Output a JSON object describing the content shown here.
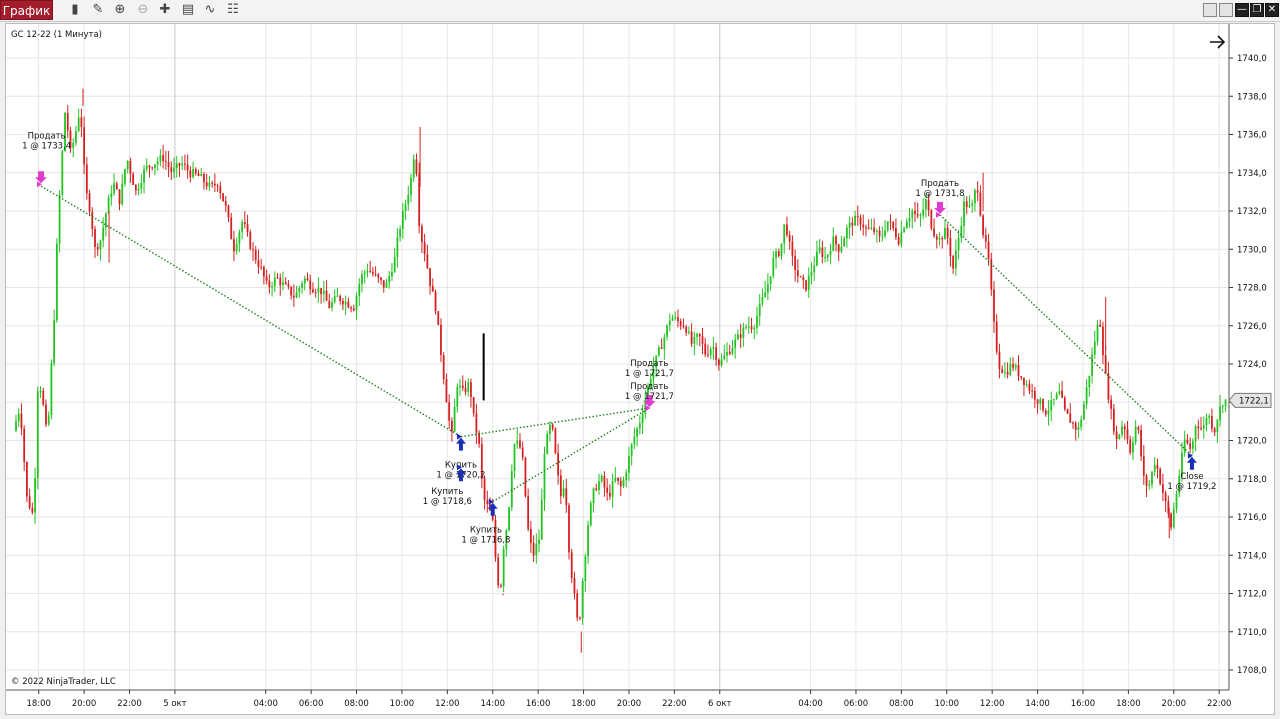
{
  "window": {
    "title": "График"
  },
  "toolbar": {
    "icons": [
      "bar-style-icon",
      "pencil-icon",
      "zoom-in-icon",
      "zoom-out-icon",
      "crosshair-icon",
      "properties-icon",
      "indicator-icon",
      "templates-icon"
    ]
  },
  "colors": {
    "up": "#22c322",
    "down": "#d42020",
    "marker_sell": "#e03cd0",
    "marker_buy": "#1a2fb5",
    "trade_line": "#208020",
    "grid": "#e6e6e6",
    "price_tag": "#e4e4e4"
  },
  "chart_data": {
    "type": "candlestick",
    "title": "GC 12-22 (1 Минута)",
    "copyright": "© 2022 NinjaTrader, LLC",
    "ylim": [
      1707.0,
      1742.0
    ],
    "y_ticks": [
      "1740,0",
      "1738,0",
      "1736,0",
      "1734,0",
      "1732,0",
      "1730,0",
      "1728,0",
      "1726,0",
      "1724,0",
      "1722,0",
      "1720,0",
      "1718,0",
      "1716,0",
      "1714,0",
      "1712,0",
      "1710,0",
      "1708,0"
    ],
    "x_ticks": [
      "18:00",
      "20:00",
      "22:00",
      "5 окт",
      "04:00",
      "06:00",
      "08:00",
      "10:00",
      "12:00",
      "14:00",
      "16:00",
      "18:00",
      "20:00",
      "22:00",
      "6 окт",
      "04:00",
      "06:00",
      "08:00",
      "10:00",
      "12:00",
      "14:00",
      "16:00",
      "18:00",
      "20:00",
      "22:00"
    ],
    "x_tick_hours": [
      18,
      20,
      22,
      24,
      28,
      30,
      32,
      34,
      36,
      38,
      40,
      42,
      44,
      46,
      48,
      52,
      54,
      56,
      58,
      60,
      62,
      64,
      66,
      68,
      70
    ],
    "x_range_hours": [
      17.0,
      70.3
    ],
    "last_price": "1722,1",
    "price_path": [
      [
        17.0,
        1720.5
      ],
      [
        17.3,
        1721.8
      ],
      [
        17.6,
        1717.0
      ],
      [
        17.9,
        1716.0
      ],
      [
        18.1,
        1723.5
      ],
      [
        18.3,
        1722.0
      ],
      [
        18.5,
        1720.0
      ],
      [
        18.8,
        1726.5
      ],
      [
        18.95,
        1731.0
      ],
      [
        19.1,
        1734.0
      ],
      [
        19.3,
        1737.5
      ],
      [
        19.5,
        1735.0
      ],
      [
        19.7,
        1735.8
      ],
      [
        19.95,
        1737.5
      ],
      [
        20.1,
        1734.5
      ],
      [
        20.2,
        1733.0
      ],
      [
        20.4,
        1732.0
      ],
      [
        20.6,
        1730.0
      ],
      [
        20.85,
        1730.5
      ],
      [
        21.1,
        1732.0
      ],
      [
        21.4,
        1733.5
      ],
      [
        21.7,
        1732.5
      ],
      [
        22.0,
        1734.8
      ],
      [
        22.4,
        1733.0
      ],
      [
        22.8,
        1734.2
      ],
      [
        23.2,
        1734.5
      ],
      [
        23.6,
        1734.8
      ],
      [
        24.0,
        1734.0
      ],
      [
        24.4,
        1734.5
      ],
      [
        24.8,
        1734.0
      ],
      [
        25.2,
        1733.8
      ],
      [
        25.7,
        1733.2
      ],
      [
        26.0,
        1733.5
      ],
      [
        26.4,
        1732.0
      ],
      [
        26.7,
        1730.0
      ],
      [
        27.1,
        1731.5
      ],
      [
        27.5,
        1730.0
      ],
      [
        27.9,
        1729.0
      ],
      [
        28.2,
        1728.0
      ],
      [
        28.6,
        1728.5
      ],
      [
        29.0,
        1728.0
      ],
      [
        29.4,
        1727.5
      ],
      [
        29.8,
        1728.5
      ],
      [
        30.2,
        1728.0
      ],
      [
        30.6,
        1727.8
      ],
      [
        30.9,
        1727.0
      ],
      [
        31.3,
        1727.5
      ],
      [
        31.7,
        1727.2
      ],
      [
        32.0,
        1727.0
      ],
      [
        32.3,
        1728.5
      ],
      [
        32.6,
        1729.0
      ],
      [
        33.0,
        1728.5
      ],
      [
        33.4,
        1728.0
      ],
      [
        33.8,
        1729.5
      ],
      [
        34.0,
        1731.0
      ],
      [
        34.3,
        1732.5
      ],
      [
        34.5,
        1733.5
      ],
      [
        34.7,
        1735.5
      ],
      [
        34.9,
        1731.0
      ],
      [
        35.1,
        1730.0
      ],
      [
        35.4,
        1728.0
      ],
      [
        35.6,
        1727.0
      ],
      [
        35.9,
        1724.0
      ],
      [
        36.1,
        1722.0
      ],
      [
        36.3,
        1720.0
      ],
      [
        36.55,
        1723.0
      ],
      [
        36.8,
        1722.5
      ],
      [
        37.1,
        1723.0
      ],
      [
        37.3,
        1721.0
      ],
      [
        37.5,
        1720.0
      ],
      [
        37.7,
        1717.0
      ],
      [
        37.9,
        1716.5
      ],
      [
        38.1,
        1716.0
      ],
      [
        38.3,
        1713.0
      ],
      [
        38.45,
        1712.0
      ],
      [
        38.6,
        1714.5
      ],
      [
        38.8,
        1716.0
      ],
      [
        38.95,
        1718.5
      ],
      [
        39.1,
        1720.0
      ],
      [
        39.4,
        1719.5
      ],
      [
        39.7,
        1715.0
      ],
      [
        39.9,
        1714.0
      ],
      [
        40.2,
        1715.0
      ],
      [
        40.4,
        1719.5
      ],
      [
        40.7,
        1721.0
      ],
      [
        40.9,
        1719.0
      ],
      [
        41.1,
        1717.0
      ],
      [
        41.3,
        1718.0
      ],
      [
        41.5,
        1714.0
      ],
      [
        41.7,
        1712.0
      ],
      [
        41.9,
        1710.0
      ],
      [
        42.1,
        1713.0
      ],
      [
        42.35,
        1716.0
      ],
      [
        42.6,
        1717.5
      ],
      [
        42.9,
        1718.0
      ],
      [
        43.2,
        1717.0
      ],
      [
        43.5,
        1718.0
      ],
      [
        43.8,
        1717.5
      ],
      [
        44.0,
        1718.5
      ],
      [
        44.3,
        1720.0
      ],
      [
        44.6,
        1721.0
      ],
      [
        44.9,
        1722.5
      ],
      [
        45.1,
        1723.5
      ],
      [
        45.4,
        1724.5
      ],
      [
        45.7,
        1725.5
      ],
      [
        45.95,
        1726.5
      ],
      [
        46.3,
        1726.2
      ],
      [
        46.6,
        1726.0
      ],
      [
        46.9,
        1725.0
      ],
      [
        47.2,
        1725.5
      ],
      [
        47.5,
        1724.5
      ],
      [
        47.8,
        1725.0
      ],
      [
        48.1,
        1724.0
      ],
      [
        48.4,
        1724.5
      ],
      [
        48.7,
        1725.0
      ],
      [
        49.0,
        1725.5
      ],
      [
        49.3,
        1726.0
      ],
      [
        49.6,
        1726.0
      ],
      [
        49.9,
        1727.0
      ],
      [
        50.2,
        1728.0
      ],
      [
        50.5,
        1729.5
      ],
      [
        50.8,
        1730.0
      ],
      [
        51.0,
        1731.5
      ],
      [
        51.3,
        1729.5
      ],
      [
        51.6,
        1728.5
      ],
      [
        51.9,
        1728.0
      ],
      [
        52.2,
        1729.0
      ],
      [
        52.5,
        1730.0
      ],
      [
        52.8,
        1729.5
      ],
      [
        53.1,
        1730.5
      ],
      [
        53.4,
        1730.0
      ],
      [
        53.7,
        1731.0
      ],
      [
        54.0,
        1731.5
      ],
      [
        54.3,
        1731.5
      ],
      [
        54.6,
        1731.0
      ],
      [
        54.9,
        1731.0
      ],
      [
        55.2,
        1730.5
      ],
      [
        55.5,
        1731.5
      ],
      [
        55.8,
        1731.0
      ],
      [
        56.0,
        1730.5
      ],
      [
        56.3,
        1731.5
      ],
      [
        56.6,
        1732.0
      ],
      [
        56.9,
        1731.5
      ],
      [
        57.2,
        1732.5
      ],
      [
        57.5,
        1731.0
      ],
      [
        57.8,
        1730.5
      ],
      [
        58.1,
        1731.0
      ],
      [
        58.4,
        1729.0
      ],
      [
        58.7,
        1731.0
      ],
      [
        58.9,
        1732.5
      ],
      [
        59.2,
        1732.0
      ],
      [
        59.45,
        1733.5
      ],
      [
        59.7,
        1731.0
      ],
      [
        59.95,
        1729.5
      ],
      [
        60.2,
        1726.0
      ],
      [
        60.4,
        1724.0
      ],
      [
        60.7,
        1723.5
      ],
      [
        61.0,
        1724.0
      ],
      [
        61.3,
        1723.5
      ],
      [
        61.6,
        1723.0
      ],
      [
        61.9,
        1722.5
      ],
      [
        62.2,
        1722.0
      ],
      [
        62.5,
        1721.5
      ],
      [
        62.8,
        1722.0
      ],
      [
        63.1,
        1722.5
      ],
      [
        63.3,
        1721.5
      ],
      [
        63.6,
        1721.0
      ],
      [
        63.9,
        1720.5
      ],
      [
        64.1,
        1721.5
      ],
      [
        64.4,
        1723.5
      ],
      [
        64.6,
        1725.0
      ],
      [
        64.85,
        1726.5
      ],
      [
        65.1,
        1723.5
      ],
      [
        65.35,
        1721.5
      ],
      [
        65.6,
        1720.0
      ],
      [
        65.9,
        1721.0
      ],
      [
        66.2,
        1719.5
      ],
      [
        66.5,
        1721.0
      ],
      [
        66.8,
        1718.0
      ],
      [
        67.0,
        1717.5
      ],
      [
        67.3,
        1719.0
      ],
      [
        67.5,
        1718.0
      ],
      [
        67.8,
        1716.5
      ],
      [
        68.0,
        1715.5
      ],
      [
        68.2,
        1717.0
      ],
      [
        68.4,
        1718.5
      ],
      [
        68.6,
        1720.0
      ],
      [
        68.9,
        1719.5
      ],
      [
        69.1,
        1721.0
      ],
      [
        69.4,
        1720.5
      ],
      [
        69.6,
        1721.5
      ],
      [
        69.9,
        1720.5
      ],
      [
        70.1,
        1721.5
      ],
      [
        70.3,
        1722.1
      ]
    ],
    "extreme_points": [
      [
        19.95,
        1738.4
      ],
      [
        21.1,
        1729.3
      ],
      [
        34.8,
        1736.4
      ],
      [
        38.45,
        1711.9
      ],
      [
        41.9,
        1708.9
      ],
      [
        59.6,
        1734.0
      ],
      [
        65.0,
        1727.5
      ],
      [
        67.8,
        1714.9
      ]
    ],
    "trades": [
      {
        "entry_hour": 18.1,
        "entry_price": 1733.3,
        "exit_hour": 36.6,
        "exit_price": 1720.2
      },
      {
        "entry_hour": 36.6,
        "entry_price": 1720.2,
        "exit_hour": 44.9,
        "exit_price": 1721.7
      },
      {
        "entry_hour": 38.0,
        "entry_price": 1716.8,
        "exit_hour": 44.9,
        "exit_price": 1721.7
      },
      {
        "entry_hour": 57.7,
        "entry_price": 1731.8,
        "exit_hour": 68.8,
        "exit_price": 1719.2
      }
    ],
    "annotations": [
      {
        "kind": "sell",
        "lines": [
          "Продать",
          "1 @ 1733,4"
        ],
        "hour": 18.1,
        "price": 1733.4,
        "label_hour": 18.35,
        "label_price": 1735.8
      },
      {
        "kind": "buy",
        "lines": [
          "Купить",
          "1 @ 1720,2"
        ],
        "hour": 36.6,
        "price": 1720.2,
        "label_hour": 36.6,
        "label_price": 1718.6
      },
      {
        "kind": "buy",
        "lines": [
          "Купить",
          "1 @ 1718,6"
        ],
        "hour": 36.6,
        "price": 1718.6,
        "label_hour": 36.0,
        "label_price": 1717.2
      },
      {
        "kind": "buy",
        "lines": [
          "Купить",
          "1 @ 1716,8"
        ],
        "hour": 38.0,
        "price": 1716.8,
        "label_hour": 37.7,
        "label_price": 1715.2
      },
      {
        "kind": "sell",
        "lines": [
          "Продать",
          "1 @ 1721,7"
        ],
        "hour": 44.9,
        "price": 1721.7,
        "label_hour": 44.9,
        "label_price": 1723.9
      },
      {
        "kind": "sell",
        "lines": [
          "Продать",
          "1 @ 1721,7"
        ],
        "hour": 44.9,
        "price": 1721.7,
        "label_hour": 44.9,
        "label_price": 1722.7
      },
      {
        "kind": "sell",
        "lines": [
          "Продать",
          "1 @ 1731,8"
        ],
        "hour": 57.7,
        "price": 1731.8,
        "label_hour": 57.7,
        "label_price": 1733.3
      },
      {
        "kind": "close",
        "lines": [
          "Close",
          "1 @ 1719,2"
        ],
        "hour": 68.8,
        "price": 1719.2,
        "label_hour": 68.8,
        "label_price": 1718.0
      }
    ]
  }
}
